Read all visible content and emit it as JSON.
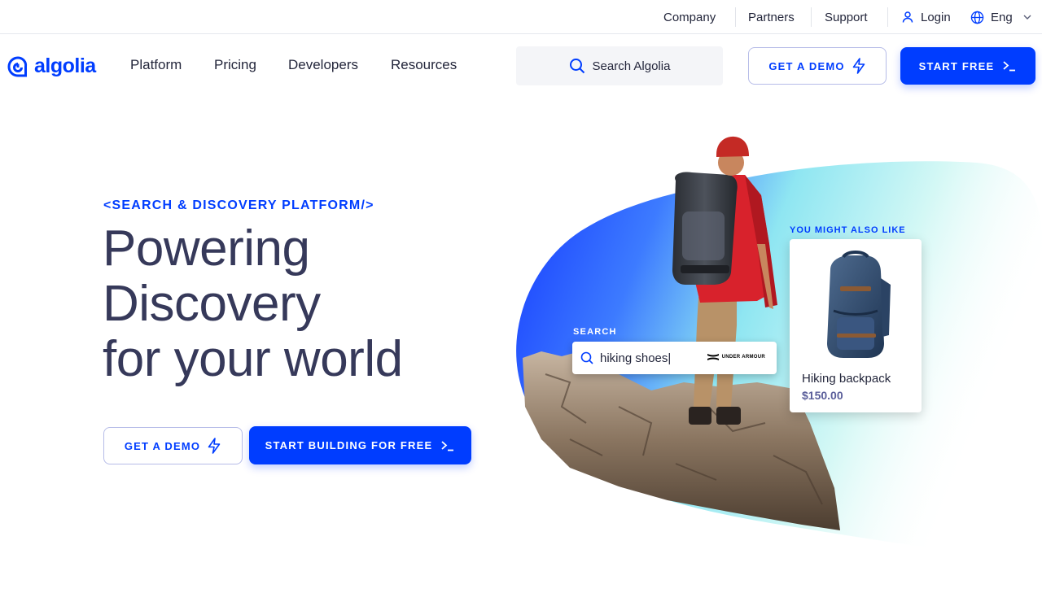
{
  "topbar": {
    "company": "Company",
    "partners": "Partners",
    "support": "Support",
    "login": "Login",
    "language": "Eng"
  },
  "nav": {
    "logo_text": "algolia",
    "links": [
      "Platform",
      "Pricing",
      "Developers",
      "Resources"
    ],
    "search_label": "Search Algolia",
    "demo_button": "GET A DEMO",
    "start_button": "START FREE"
  },
  "hero": {
    "eyebrow": "<SEARCH & DISCOVERY PLATFORM/>",
    "headline_lines": [
      "Powering",
      "Discovery",
      "for your world"
    ],
    "demo_button": "GET A DEMO",
    "start_button": "START BUILDING FOR FREE"
  },
  "showcase": {
    "search_label": "SEARCH",
    "search_query": "hiking shoes|",
    "brand": "UNDER ARMOUR",
    "recommend_label": "YOU MIGHT ALSO LIKE",
    "product_name": "Hiking backpack",
    "product_price": "$150.00"
  },
  "colors": {
    "brand": "#003dff",
    "text": "#23263b",
    "headline": "#36395a"
  },
  "icons": [
    "user-icon",
    "globe-icon",
    "chevron-down-icon",
    "search-icon",
    "lightning-icon",
    "terminal-prompt-icon",
    "algolia-logo-icon"
  ]
}
